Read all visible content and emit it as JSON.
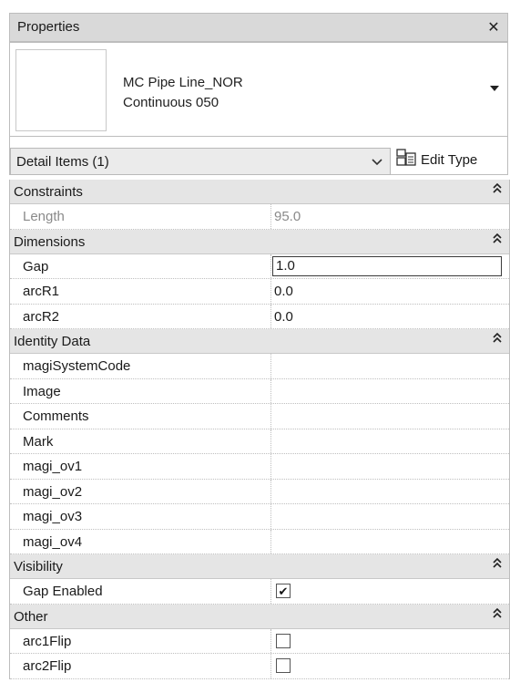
{
  "window": {
    "title": "Properties",
    "close_glyph": "✕"
  },
  "type_selector": {
    "name_line1": "MC Pipe Line_NOR",
    "name_line2": "Continuous 050"
  },
  "filter": {
    "selected": "Detail Items (1)",
    "chevron": "⌄",
    "edit_type_label": "Edit Type"
  },
  "groups": [
    {
      "name": "Constraints",
      "rows": [
        {
          "label": "Length",
          "value": "95.0",
          "kind": "readonly"
        }
      ]
    },
    {
      "name": "Dimensions",
      "rows": [
        {
          "label": "Gap",
          "value": "1.0",
          "kind": "active"
        },
        {
          "label": "arcR1",
          "value": "0.0",
          "kind": "text"
        },
        {
          "label": "arcR2",
          "value": "0.0",
          "kind": "text"
        }
      ]
    },
    {
      "name": "Identity Data",
      "rows": [
        {
          "label": "magiSystemCode",
          "value": "",
          "kind": "text"
        },
        {
          "label": "Image",
          "value": "",
          "kind": "text"
        },
        {
          "label": "Comments",
          "value": "",
          "kind": "text"
        },
        {
          "label": "Mark",
          "value": "",
          "kind": "text"
        },
        {
          "label": "magi_ov1",
          "value": "",
          "kind": "text"
        },
        {
          "label": "magi_ov2",
          "value": "",
          "kind": "text"
        },
        {
          "label": "magi_ov3",
          "value": "",
          "kind": "text"
        },
        {
          "label": "magi_ov4",
          "value": "",
          "kind": "text"
        }
      ]
    },
    {
      "name": "Visibility",
      "rows": [
        {
          "label": "Gap Enabled",
          "checked": true,
          "kind": "check"
        }
      ]
    },
    {
      "name": "Other",
      "rows": [
        {
          "label": "arc1Flip",
          "checked": false,
          "kind": "check"
        },
        {
          "label": "arc2Flip",
          "checked": false,
          "kind": "check"
        }
      ]
    }
  ],
  "collapse_glyph": "≈",
  "check_glyph": "✔"
}
